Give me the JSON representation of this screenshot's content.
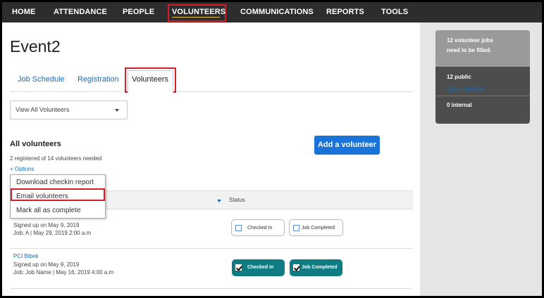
{
  "nav": {
    "items": [
      {
        "label": "HOME"
      },
      {
        "label": "ATTENDANCE"
      },
      {
        "label": "PEOPLE"
      },
      {
        "label": "VOLUNTEERS"
      },
      {
        "label": "COMMUNICATIONS"
      },
      {
        "label": "REPORTS"
      },
      {
        "label": "TOOLS"
      }
    ],
    "active": "VOLUNTEERS"
  },
  "page": {
    "title": "Event2"
  },
  "tabs": [
    {
      "label": "Job Schedule"
    },
    {
      "label": "Registration"
    },
    {
      "label": "Volunteers"
    }
  ],
  "filter": {
    "selected": "View All Volunteers"
  },
  "volunteers": {
    "heading": "All volunteers",
    "registered_text": "2 registered of 14 volunteers needed",
    "options_label": "+ Options",
    "add_button": "Add a volunteer",
    "status_header": "Status"
  },
  "options_menu": {
    "items": [
      {
        "label": "Download checkin report"
      },
      {
        "label": "Email volunteers"
      },
      {
        "label": "Mark all as complete"
      }
    ]
  },
  "rows": [
    {
      "name": "",
      "signed_up": "Signed up on May 9, 2019",
      "job": "Job: A | May 29, 2019 2:00 a.m",
      "checked_in": {
        "label": "Checked In",
        "checked": false
      },
      "job_completed": {
        "label": "Job Completed",
        "checked": false
      }
    },
    {
      "name": "PCI Bibek",
      "signed_up": "Signed up on May 9, 2019",
      "job": "Job: Job Name | May 16, 2019 4:00 a.m",
      "checked_in": {
        "label": "Checked In",
        "checked": true
      },
      "job_completed": {
        "label": "Job Completed",
        "checked": true
      }
    }
  ],
  "stats": {
    "headline_line1": "12 volunteer jobs",
    "headline_line2": "need to be filled.",
    "public": "12 public",
    "email_reminder": "Email reminder",
    "internal": "0 internal"
  },
  "colors": {
    "nav_bg": "#2d2d2d",
    "highlight_red": "#d2202a",
    "link_blue": "#1a6eb8",
    "primary_button": "#1a73d8",
    "status_on": "#0f7c84"
  }
}
